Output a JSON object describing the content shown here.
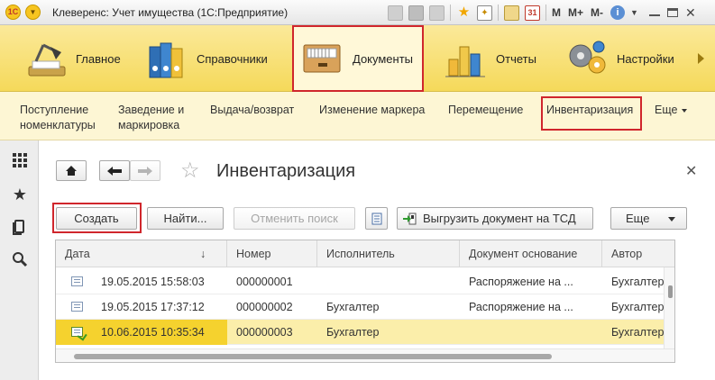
{
  "window": {
    "title": "Клеверенс: Учет имущества  (1С:Предприятие)",
    "logo_text": "1С",
    "memory_buttons": [
      "M",
      "M+",
      "M-"
    ],
    "calendar_day": "31"
  },
  "sections": [
    {
      "label": "Главное",
      "icon": "desk-lamp-icon"
    },
    {
      "label": "Справочники",
      "icon": "binders-icon"
    },
    {
      "label": "Документы",
      "icon": "file-cabinet-icon",
      "active": true
    },
    {
      "label": "Отчеты",
      "icon": "bar-chart-icon"
    },
    {
      "label": "Настройки",
      "icon": "gears-icon"
    }
  ],
  "nav": {
    "items": [
      {
        "label": "Поступление\nноменклатуры"
      },
      {
        "label": "Заведение и\nмаркировка"
      },
      {
        "label": "Выдача/возврат"
      },
      {
        "label": "Изменение маркера"
      },
      {
        "label": "Перемещение"
      },
      {
        "label": "Инвентаризация",
        "active": true
      }
    ],
    "more_label": "Еще"
  },
  "form": {
    "title": "Инвентаризация",
    "buttons": {
      "create": "Создать",
      "find": "Найти...",
      "cancel_search": "Отменить поиск",
      "export": "Выгрузить документ на ТСД",
      "more": "Еще"
    }
  },
  "table": {
    "columns": [
      "Дата",
      "Номер",
      "Исполнитель",
      "Документ основание",
      "Автор"
    ],
    "sort_indicator": "↓",
    "rows": [
      {
        "date": "19.05.2015 15:58:03",
        "number": "000000001",
        "executor": "",
        "basis": "Распоряжение на ...",
        "author": "Бухгалтер",
        "status": "draft"
      },
      {
        "date": "19.05.2015 17:37:12",
        "number": "000000002",
        "executor": "Бухгалтер",
        "basis": "Распоряжение на ...",
        "author": "Бухгалтер",
        "status": "draft"
      },
      {
        "date": "10.06.2015 10:35:34",
        "number": "000000003",
        "executor": "Бухгалтер",
        "basis": "",
        "author": "Бухгалтер",
        "status": "posted",
        "selected": true
      }
    ]
  }
}
